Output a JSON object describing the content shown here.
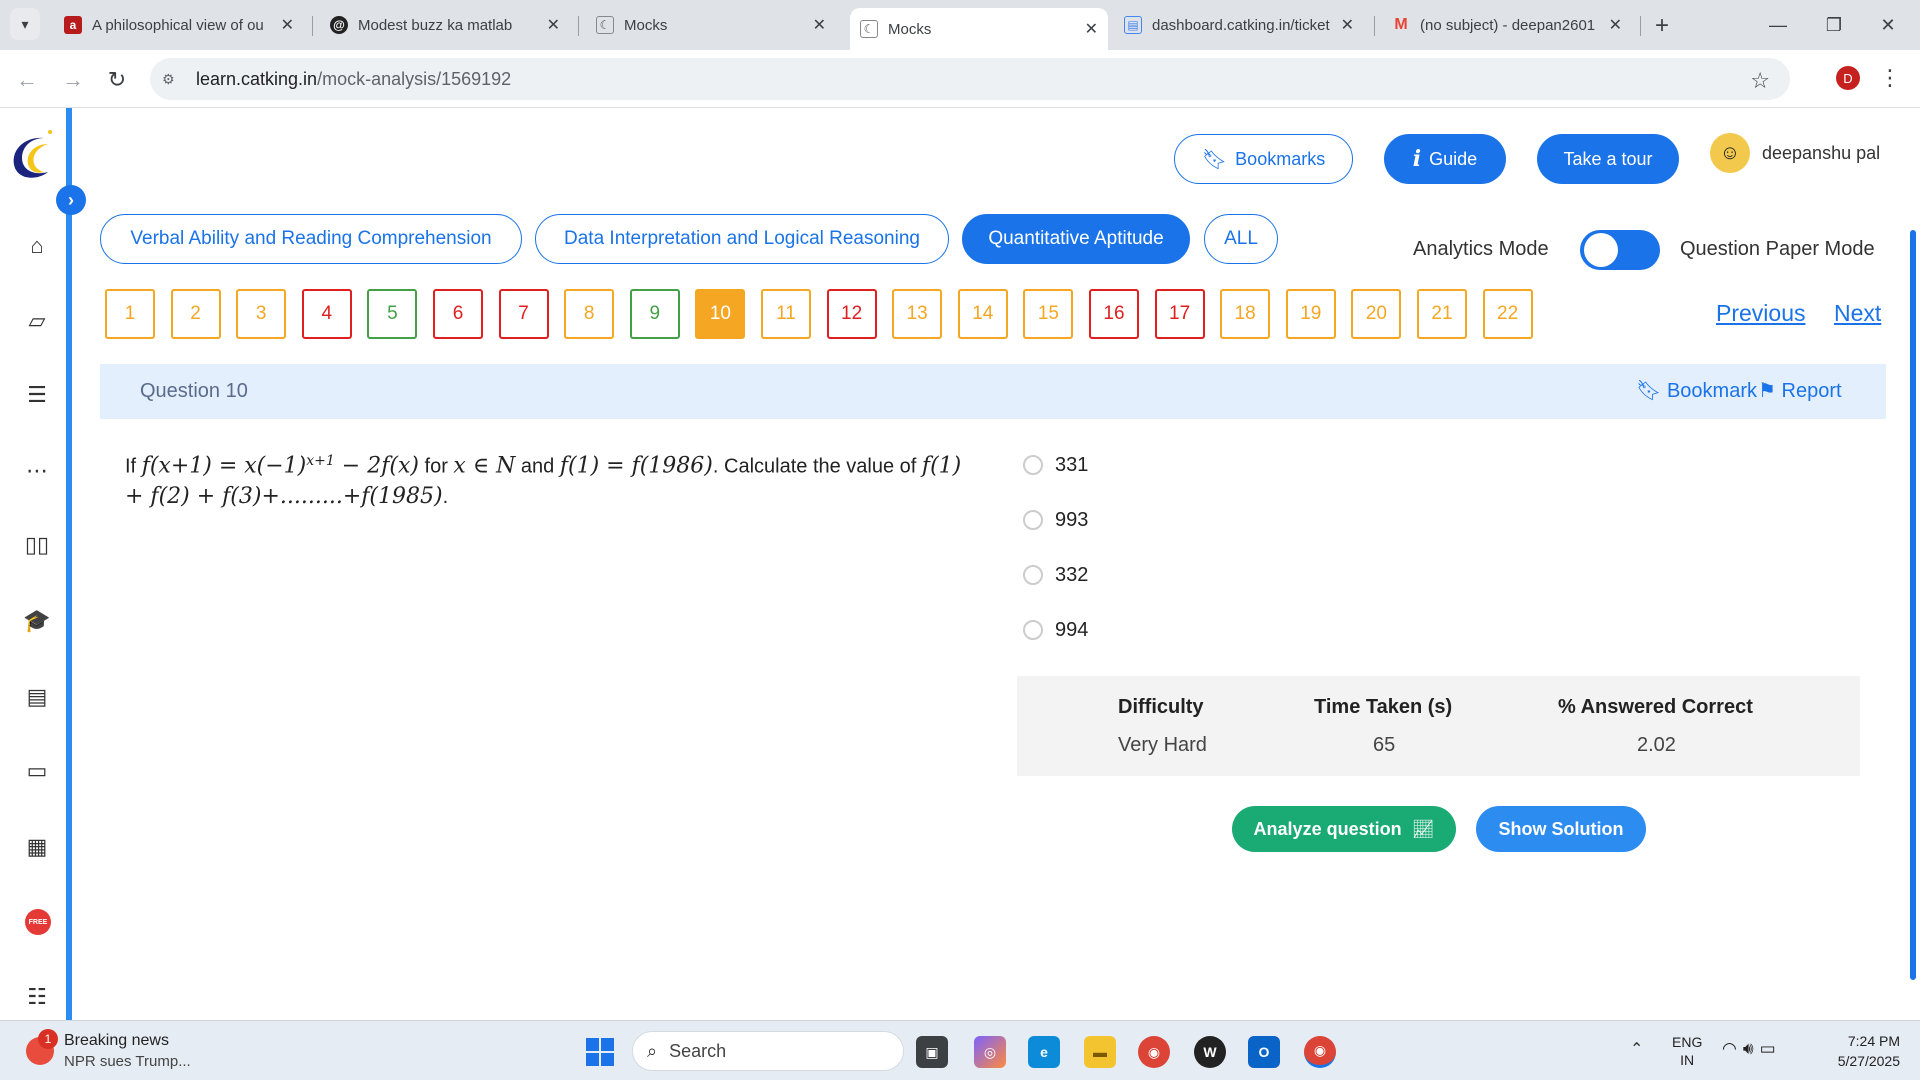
{
  "browser": {
    "tabs": [
      {
        "title": "A philosophical view of ou",
        "favicon": "a"
      },
      {
        "title": "Modest buzz ka matlab",
        "favicon": "threads"
      },
      {
        "title": "Mocks",
        "favicon": "catking"
      },
      {
        "title": "Mocks",
        "favicon": "catking"
      },
      {
        "title": "dashboard.catking.in/ticket",
        "favicon": "doc"
      },
      {
        "title": "(no subject) - deepan2601",
        "favicon": "gmail"
      }
    ],
    "url_domain": "learn.catking.in",
    "url_path": "/mock-analysis/1569192",
    "profile_initial": "D"
  },
  "header": {
    "bookmarks_label": "Bookmarks",
    "guide_label": "Guide",
    "tour_label": "Take a tour",
    "user_name": "deepanshu pal"
  },
  "sections": [
    {
      "label": "Verbal Ability and Reading Comprehension"
    },
    {
      "label": "Data Interpretation and Logical Reasoning"
    },
    {
      "label": "Quantitative Aptitude"
    },
    {
      "label": "ALL"
    }
  ],
  "mode": {
    "analytics_label": "Analytics Mode",
    "paper_label": "Question Paper Mode"
  },
  "question_numbers": [
    "1",
    "2",
    "3",
    "4",
    "5",
    "6",
    "7",
    "8",
    "9",
    "10",
    "11",
    "12",
    "13",
    "14",
    "15",
    "16",
    "17",
    "18",
    "19",
    "20",
    "21",
    "22"
  ],
  "question_status": [
    "skipped",
    "skipped",
    "skipped",
    "wrong",
    "correct",
    "wrong",
    "wrong",
    "skipped",
    "correct",
    "current",
    "skipped",
    "wrong",
    "skipped",
    "skipped",
    "skipped",
    "wrong",
    "wrong",
    "skipped",
    "skipped",
    "skipped",
    "skipped",
    "skipped"
  ],
  "pagination": {
    "previous": "Previous",
    "next": "Next"
  },
  "question": {
    "title": "Question 10",
    "bookmark_label": "Bookmark",
    "report_label": "Report",
    "text_if": "If",
    "expr1": "f(x+1) = x(−1)",
    "expr1_sup": "x+1",
    "expr1_tail": " − 2f(x)",
    "text_for": "for",
    "expr2": "x ∈ N",
    "text_and": "and",
    "expr3": "f(1) = f(1986)",
    "text_calc": ". Calculate the value of",
    "expr4": "f(1) + f(2) + f(3)+.........+f(1985)",
    "text_end": ".",
    "options": [
      "331",
      "993",
      "332",
      "994"
    ]
  },
  "stats": {
    "difficulty_label": "Difficulty",
    "difficulty_value": "Very Hard",
    "time_label": "Time Taken (s)",
    "time_value": "65",
    "correct_label": "% Answered Correct",
    "correct_value": "2.02"
  },
  "actions": {
    "analyze_label": "Analyze question",
    "solution_label": "Show Solution"
  },
  "taskbar": {
    "news_count": "1",
    "news_title": "Breaking news",
    "news_sub": "NPR sues Trump...",
    "search_text": "Search",
    "lang_top": "ENG",
    "lang_bottom": "IN",
    "time": "7:24 PM",
    "date": "5/27/2025"
  }
}
